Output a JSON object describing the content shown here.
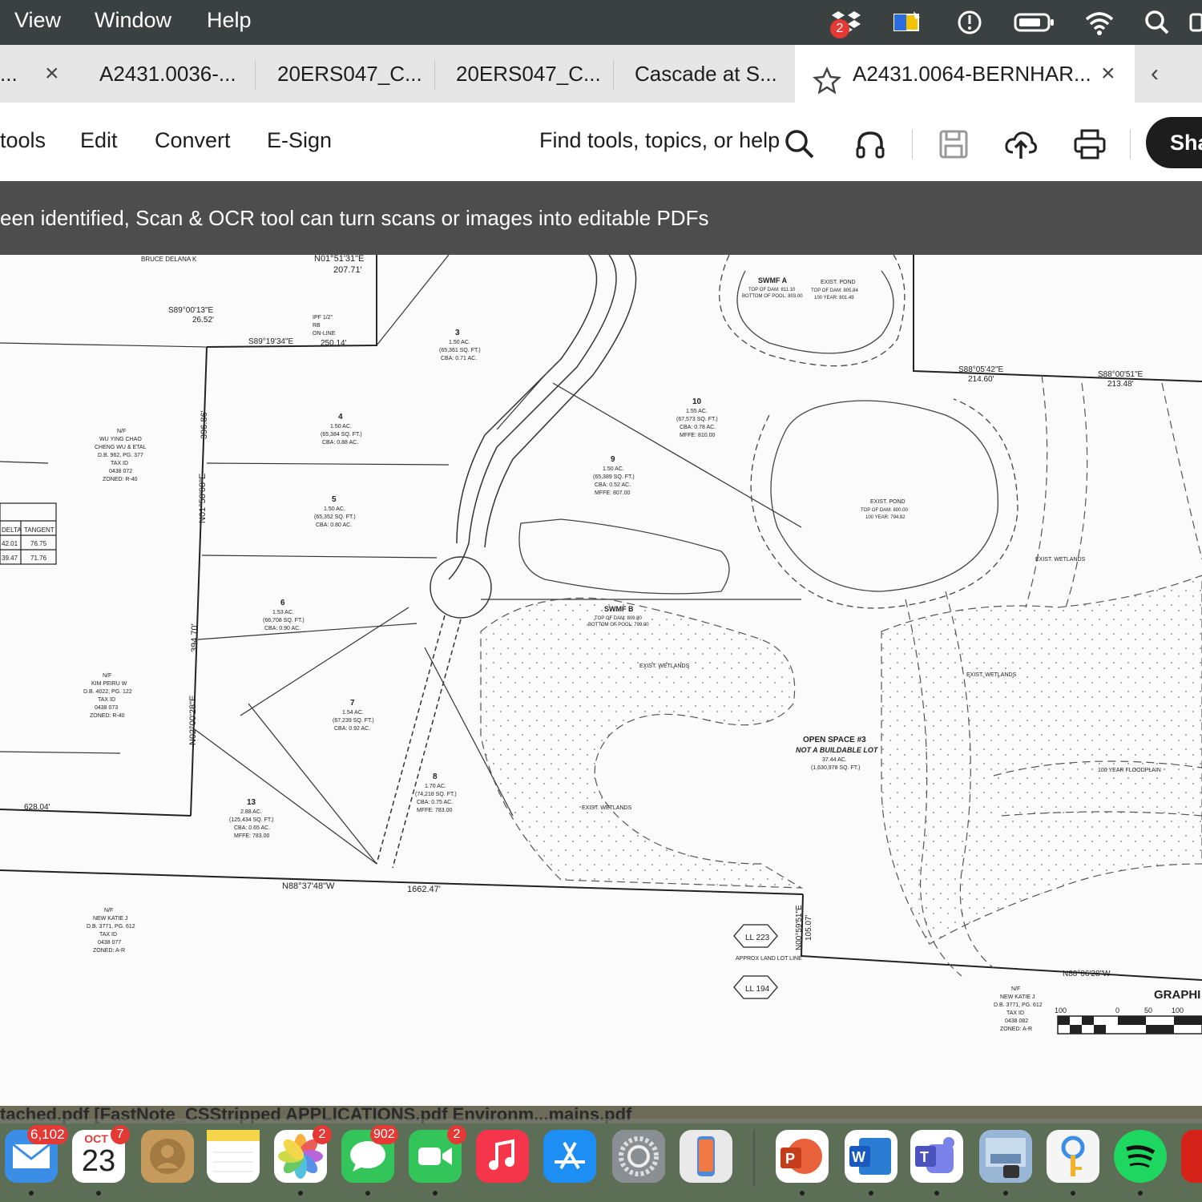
{
  "menubar": {
    "items": [
      "View",
      "Window",
      "Help"
    ],
    "dropbox_badge": "2"
  },
  "tabs": [
    {
      "label": "..."
    },
    {
      "label": "A2431.0036-..."
    },
    {
      "label": "20ERS047_C..."
    },
    {
      "label": "20ERS047_C..."
    },
    {
      "label": "Cascade at S..."
    },
    {
      "label": "A2431.0064-BERNHAR..."
    }
  ],
  "toolbar": {
    "items": [
      "tools",
      "Edit",
      "Convert",
      "E-Sign"
    ],
    "search_label": "Find tools, topics, or help",
    "share_label": "Sha"
  },
  "notice": {
    "text": "een identified, Scan & OCR tool can turn scans or images into editable PDFs"
  },
  "plan": {
    "top_labels": {
      "owner1": "BRUCE DELANA K",
      "bearing1": "N01°51'31\"E",
      "dist1": "207.71'",
      "bearing2": "S89°00'13\"E",
      "dist2": "26.52'",
      "bearing3": "S89°19'34\"E",
      "dist3": "250.14'",
      "ipf": "IPF 1/2\"",
      "rb": "RB",
      "on_line": "ON-LINE"
    },
    "lots": {
      "lot3": {
        "num": "3",
        "ac": "1.50 AC.",
        "sqft": "(65,361 SQ. FT.)",
        "cba": "CBA: 0.71 AC."
      },
      "lot4": {
        "num": "4",
        "ac": "1.50 AC.",
        "sqft": "(65,384 SQ. FT.)",
        "cba": "CBA: 0.88 AC."
      },
      "lot5": {
        "num": "5",
        "ac": "1.50 AC.",
        "sqft": "(65,352 SQ. FT.)",
        "cba": "CBA: 0.80 AC."
      },
      "lot6": {
        "num": "6",
        "ac": "1.53 AC.",
        "sqft": "(66,708 SQ. FT.)",
        "cba": "CBA: 0.90 AC."
      },
      "lot7": {
        "num": "7",
        "ac": "1.54 AC.",
        "sqft": "(67,239 SQ. FT.)",
        "cba": "CBA: 0.92 AC."
      },
      "lot8": {
        "num": "8",
        "ac": "1.70 AC.",
        "sqft": "(74,218 SQ. FT.)",
        "cba": "CBA: 0.75 AC.",
        "mffe": "MFFE: 783.00"
      },
      "lot9": {
        "num": "9",
        "ac": "1.50 AC.",
        "sqft": "(65,389 SQ. FT.)",
        "cba": "CBA: 0.52 AC.",
        "mffe": "MFFE: 807.00"
      },
      "lot10": {
        "num": "10",
        "ac": "1.55 AC.",
        "sqft": "(67,573 SQ. FT.)",
        "cba": "CBA: 0.78 AC.",
        "mffe": "MFFE: 810.00"
      },
      "lot13": {
        "num": "13",
        "ac": "2.88 AC.",
        "sqft": "(125,434 SQ. FT.)",
        "cba": "CBA: 0.65 AC.",
        "mffe": "MFFE: 783.00"
      }
    },
    "swmf_a": {
      "title": "SWMF A",
      "line1": "TOP OF DAM: 811.10",
      "line2": "BOTTOM OF POOL: 803.00"
    },
    "swmf_b": {
      "title": "SWMF B",
      "line1": "TOP OF DAM: 809.80",
      "line2": "BOTTOM OF POOL: 799.00"
    },
    "exist_pond_top": {
      "title": "EXIST. POND",
      "line1": "TOP OF DAM: 805.84",
      "line2": "100 YEAR: 801.49"
    },
    "exist_pond_right": {
      "title": "EXIST. POND",
      "line1": "TOP OF DAM: 800.00",
      "line2": "100 YEAR: 794.82"
    },
    "open_space": {
      "title": "OPEN SPACE #3",
      "subtitle": "NOT A BUILDABLE LOT",
      "ac": "37.44 AC.",
      "sqft": "(1,630,978 SQ. FT.)"
    },
    "exist_wetlands": "EXIST. WETLANDS",
    "floodplain": "100 YEAR FLOODPLAIN",
    "owner_left": [
      "N/F",
      "WU YING CHAO",
      "CHENG WU & ETAL",
      "D.B. 962, PG. 377",
      "TAX ID",
      "0438 072",
      "ZONED: R-40"
    ],
    "owner_left2": [
      "N/F",
      "KIM PEIRU W",
      "D.B. 4022, PG. 122",
      "TAX ID",
      "0438 073",
      "ZONED: R-40"
    ],
    "owner_bottom": [
      "N/F",
      "NEW KATIE J",
      "D.B. 3771, PG. 612",
      "TAX ID",
      "0438 077",
      "ZONED: A-R"
    ],
    "owner_bottom_right": [
      "N/F",
      "NEW KATIE J",
      "D.B. 3771, PG. 612",
      "TAX ID",
      "0438 082",
      "ZONED: A-R"
    ],
    "bearings": {
      "n01_58": "N01°58'08\"E",
      "n02_00": "N02°00'28\"E",
      "dist_396": "396.86'",
      "dist_394": "394.70'",
      "dist_628": "628.04'",
      "n88_37": "N88°37'48\"W",
      "dist_1662": "1662.47'",
      "s88_05": "S88°05'42\"E",
      "dist_214": "214.60'",
      "s88_00": "S88°00'51\"E",
      "dist_213": "213.48'",
      "n88_06": "N88°06'28\"W",
      "n00_59": "N00°59'51\"E",
      "dist_105": "105.07'"
    },
    "ll_223": "LL 223",
    "ll_194": "LL 194",
    "approx_land_lot": "APPROX LAND LOT LINE",
    "graphic_scale": "GRAPHI",
    "scale_ticks": [
      "100",
      "0",
      "50",
      "100"
    ],
    "curve_table": {
      "headers": [
        "DELTA",
        "TANGENT"
      ],
      "rows": [
        [
          "42.01",
          "76.75"
        ],
        [
          "39.47",
          "71.76"
        ]
      ]
    }
  },
  "dock": {
    "strip_text": "tached.pdf        [FastNote_CSStripped APPLICATIONS.pdf              Environm...mains.pdf",
    "mail_badge": "6,102",
    "calendar_month": "OCT",
    "calendar_day": "23",
    "calendar_badge": "7",
    "photos_badge": "2",
    "messages_badge": "902",
    "facetime_badge": "2"
  }
}
